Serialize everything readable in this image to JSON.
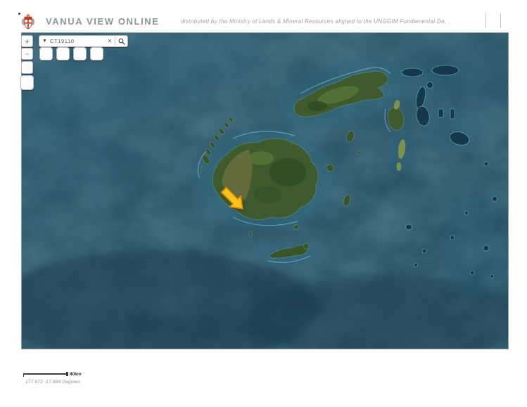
{
  "header": {
    "title": "VANUA VIEW ONLINE",
    "subtitle": "distributed by the Ministry of Lands & Mineral Resources aligned to the UNGGIM Fundamental Da.",
    "logo": "fiji-coat-of-arms"
  },
  "controls": {
    "zoom_in_label": "+",
    "zoom_out_label": "−",
    "dropdown_icon": "▼",
    "clear_icon": "✕",
    "search_icon": "magnifier",
    "search_value": "CT19110"
  },
  "map": {
    "marker": "yellow-arrow-marker"
  },
  "footer": {
    "scale_label": "40km",
    "coordinates": "177.472 -17.884 Degrees"
  },
  "colors": {
    "ocean": "#1c4154",
    "ocean_deep": "#14364a",
    "shallow_reef_halo": "#2e6a80",
    "land": "#3f5a2c",
    "land_dry": "#70713f",
    "reef_line": "#8ed4e4",
    "marker_fill": "#ffc21a",
    "marker_stroke": "#c8860a",
    "title_gray": "#8d959c"
  }
}
